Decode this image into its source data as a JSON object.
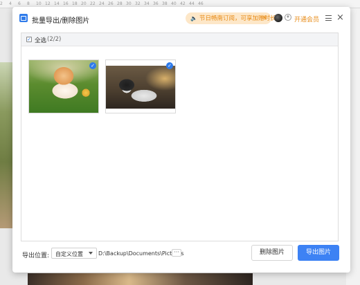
{
  "ruler": {
    "ticks": [
      "2",
      "4",
      "6",
      "8",
      "10",
      "12",
      "14",
      "16",
      "18",
      "20",
      "22",
      "24",
      "26",
      "28",
      "30",
      "32",
      "34",
      "36",
      "38",
      "40",
      "42",
      "44",
      "46"
    ]
  },
  "dialog": {
    "title": "批量导出/删除图片",
    "promo": {
      "text": "节日畅南订阅，可享加赠时长",
      "close": "×"
    },
    "vip_link": "开通会员",
    "close": "×"
  },
  "selection": {
    "checkbox_mark": "✓",
    "select_all_label": "全选",
    "count": "(2/2)"
  },
  "images": [
    {
      "checked": true,
      "check_mark": "✓"
    },
    {
      "checked": true,
      "check_mark": "✓"
    }
  ],
  "footer": {
    "export_location_label": "导出位置:",
    "location_value": "自定义位置",
    "path": "D:\\Backup\\Documents\\Pictures",
    "browse": "···",
    "delete_button": "删除图片",
    "export_button": "导出图片"
  },
  "colors": {
    "accent": "#3d82f4",
    "promo_text": "#e78a14",
    "promo_bg": "#fde7c8"
  }
}
